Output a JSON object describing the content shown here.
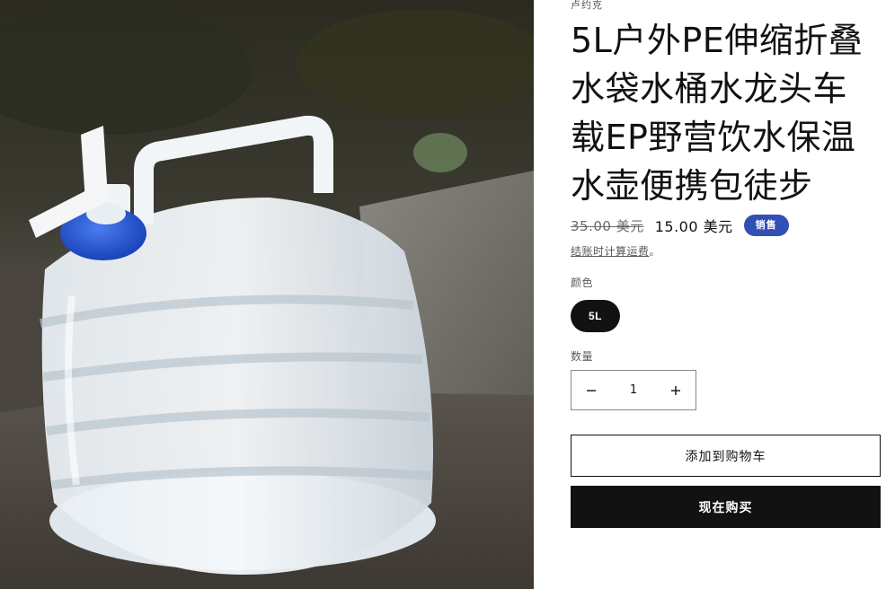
{
  "product": {
    "vendor": "卢约克",
    "title": "5L户外PE伸缩折叠水袋水桶水龙头车载EP野营饮水保温水壶便携包徒步",
    "price_compare": "35.00 美元",
    "price_sale": "15.00 美元",
    "sale_badge": "销售",
    "shipping_link": "结账时计算运费",
    "shipping_suffix": "。"
  },
  "variant": {
    "label": "颜色",
    "selected": "5L"
  },
  "quantity": {
    "label": "数量",
    "value": "1",
    "decrease_icon": "minus-icon",
    "increase_icon": "plus-icon"
  },
  "actions": {
    "add_to_cart": "添加到购物车",
    "buy_now": "现在购买"
  },
  "colors": {
    "badge": "#334fb4",
    "primary": "#121212",
    "cap_blue": "#1f4fd1"
  }
}
